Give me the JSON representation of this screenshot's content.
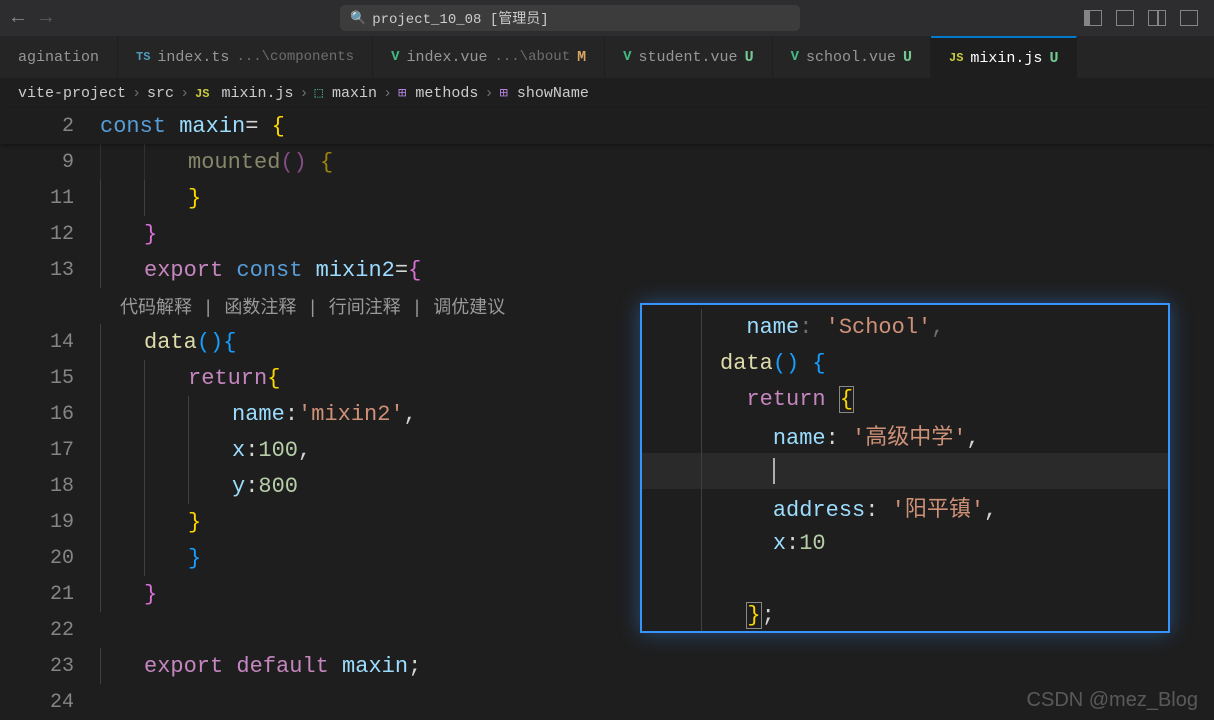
{
  "titlebar": {
    "search_text": "project_10_08 [管理员]"
  },
  "tabs": [
    {
      "label": "agination",
      "icon": "",
      "suffix": ""
    },
    {
      "label": "index.ts",
      "icon": "TS",
      "suffix": "...\\components"
    },
    {
      "label": "index.vue",
      "icon": "V",
      "suffix": "...\\about",
      "mod": "M"
    },
    {
      "label": "student.vue",
      "icon": "V",
      "suffix": "",
      "untracked": "U"
    },
    {
      "label": "school.vue",
      "icon": "V",
      "suffix": "",
      "untracked": "U"
    },
    {
      "label": "mixin.js",
      "icon": "JS",
      "suffix": "",
      "untracked": "U",
      "active": true
    }
  ],
  "breadcrumb": {
    "parts": [
      "vite-project",
      "src",
      "mixin.js",
      "maxin",
      "methods",
      "showName"
    ]
  },
  "sticky": {
    "line_no": "2",
    "code_html": "const maxin= {"
  },
  "code_lines": [
    {
      "no": "9",
      "indent": 2,
      "tokens": [
        [
          "fn",
          "mounted"
        ],
        [
          "brace-p",
          "()"
        ],
        [
          "plain",
          " "
        ],
        [
          "brace-y",
          "{"
        ]
      ],
      "dim": true
    },
    {
      "no": "11",
      "indent": 2,
      "tokens": [
        [
          "brace-y",
          "}"
        ]
      ]
    },
    {
      "no": "12",
      "indent": 1,
      "tokens": [
        [
          "brace-p",
          "}"
        ]
      ]
    },
    {
      "no": "13",
      "indent": 1,
      "tokens": [
        [
          "kw",
          "export"
        ],
        [
          "plain",
          " "
        ],
        [
          "kw2",
          "const"
        ],
        [
          "plain",
          " "
        ],
        [
          "var",
          "mixin2"
        ],
        [
          "plain",
          "="
        ],
        [
          "brace-p",
          "{"
        ]
      ]
    },
    {
      "no": "",
      "indent": 0,
      "codelens": "代码解释 | 函数注释 | 行间注释 | 调优建议"
    },
    {
      "no": "14",
      "indent": 1,
      "tokens": [
        [
          "fn",
          "data"
        ],
        [
          "brace-b",
          "()"
        ],
        [
          "brace-b",
          "{"
        ]
      ]
    },
    {
      "no": "15",
      "indent": 2,
      "tokens": [
        [
          "kw",
          "return"
        ],
        [
          "brace-y",
          "{"
        ]
      ]
    },
    {
      "no": "16",
      "indent": 3,
      "tokens": [
        [
          "var",
          "name"
        ],
        [
          "plain",
          ":"
        ],
        [
          "str",
          "'mixin2'"
        ],
        [
          "plain",
          ","
        ]
      ]
    },
    {
      "no": "17",
      "indent": 3,
      "tokens": [
        [
          "var",
          "x"
        ],
        [
          "plain",
          ":"
        ],
        [
          "num",
          "100"
        ],
        [
          "plain",
          ","
        ]
      ]
    },
    {
      "no": "18",
      "indent": 3,
      "tokens": [
        [
          "var",
          "y"
        ],
        [
          "plain",
          ":"
        ],
        [
          "num",
          "800"
        ]
      ]
    },
    {
      "no": "19",
      "indent": 2,
      "tokens": [
        [
          "brace-y",
          "}"
        ]
      ]
    },
    {
      "no": "20",
      "indent": 2,
      "tokens": [
        [
          "brace-b",
          "}"
        ]
      ]
    },
    {
      "no": "21",
      "indent": 1,
      "tokens": [
        [
          "brace-p",
          "}"
        ]
      ]
    },
    {
      "no": "22",
      "indent": 0,
      "tokens": []
    },
    {
      "no": "23",
      "indent": 1,
      "tokens": [
        [
          "kw",
          "export"
        ],
        [
          "plain",
          " "
        ],
        [
          "kw",
          "default"
        ],
        [
          "plain",
          " "
        ],
        [
          "var",
          "maxin"
        ],
        [
          "plain",
          ";"
        ]
      ]
    },
    {
      "no": "24",
      "indent": 0,
      "tokens": []
    }
  ],
  "popup_lines": [
    {
      "tokens": [
        [
          "var",
          "name"
        ],
        [
          "plain",
          ": "
        ],
        [
          "str",
          "'School'"
        ],
        [
          "plain",
          ","
        ]
      ],
      "dim": true,
      "indent": 1
    },
    {
      "tokens": [
        [
          "fn",
          "data"
        ],
        [
          "brace-b",
          "()"
        ],
        [
          "plain",
          " "
        ],
        [
          "brace-b",
          "{"
        ]
      ],
      "indent": 0
    },
    {
      "tokens": [
        [
          "kw",
          "return"
        ],
        [
          "plain",
          " "
        ],
        [
          "brace-y bracket-hl",
          "{"
        ]
      ],
      "indent": 1
    },
    {
      "tokens": [
        [
          "var",
          "name"
        ],
        [
          "plain",
          ": "
        ],
        [
          "str",
          "'高级中学'"
        ],
        [
          "plain",
          ","
        ]
      ],
      "indent": 2
    },
    {
      "tokens": [],
      "current": true,
      "cursor": true,
      "indent": 2
    },
    {
      "tokens": [
        [
          "var",
          "address"
        ],
        [
          "plain",
          ": "
        ],
        [
          "str",
          "'阳平镇'"
        ],
        [
          "plain",
          ","
        ]
      ],
      "indent": 2
    },
    {
      "tokens": [
        [
          "var",
          "x"
        ],
        [
          "plain",
          ":"
        ],
        [
          "num",
          "10"
        ]
      ],
      "indent": 2
    },
    {
      "tokens": [],
      "indent": 0
    },
    {
      "tokens": [
        [
          "brace-y bracket-hl",
          "}"
        ],
        [
          "plain",
          ";"
        ]
      ],
      "indent": 1
    },
    {
      "tokens": [
        [
          "brace-b",
          "}"
        ],
        [
          "plain",
          ","
        ]
      ],
      "indent": 0,
      "dim": true
    }
  ],
  "watermark": "CSDN @mez_Blog"
}
